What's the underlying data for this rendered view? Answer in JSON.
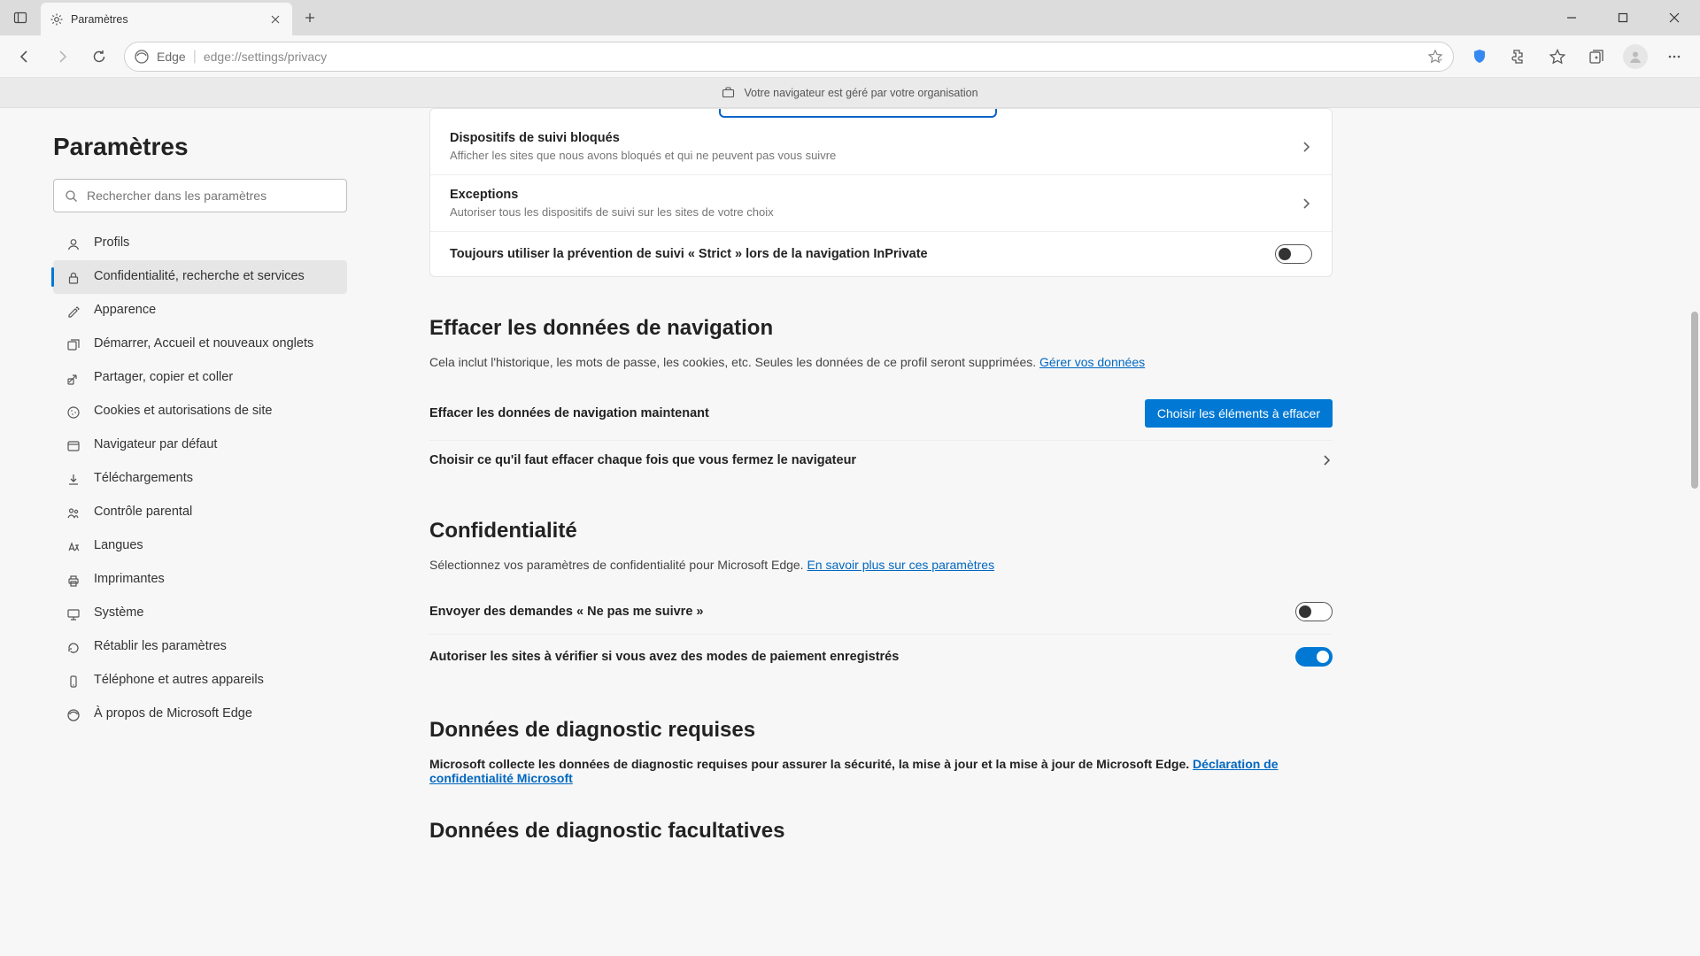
{
  "tab": {
    "title": "Paramètres"
  },
  "address": {
    "app": "Edge",
    "url": "edge://settings/privacy"
  },
  "org_banner": "Votre navigateur est géré par votre organisation",
  "sidebar": {
    "title": "Paramètres",
    "search_placeholder": "Rechercher dans les paramètres",
    "items": [
      "Profils",
      "Confidentialité, recherche et services",
      "Apparence",
      "Démarrer, Accueil et nouveaux onglets",
      "Partager, copier et coller",
      "Cookies et autorisations de site",
      "Navigateur par défaut",
      "Téléchargements",
      "Contrôle parental",
      "Langues",
      "Imprimantes",
      "Système",
      "Rétablir les paramètres",
      "Téléphone et autres appareils",
      "À propos de Microsoft Edge"
    ]
  },
  "card": {
    "rows": [
      {
        "title": "Dispositifs de suivi bloqués",
        "sub": "Afficher les sites que nous avons bloqués et qui ne peuvent pas vous suivre"
      },
      {
        "title": "Exceptions",
        "sub": "Autoriser tous les dispositifs de suivi sur les sites de votre choix"
      },
      {
        "title": "Toujours utiliser la prévention de suivi « Strict » lors de la navigation InPrivate"
      }
    ]
  },
  "clear": {
    "title": "Effacer les données de navigation",
    "desc": "Cela inclut l'historique, les mots de passe, les cookies, etc. Seules les données de ce profil seront supprimées. ",
    "link": "Gérer vos données",
    "row1": "Effacer les données de navigation maintenant",
    "btn": "Choisir les éléments à effacer",
    "row2": "Choisir ce qu'il faut effacer chaque fois que vous fermez le navigateur"
  },
  "privacy": {
    "title": "Confidentialité",
    "desc": "Sélectionnez vos paramètres de confidentialité pour Microsoft Edge. ",
    "link": "En savoir plus sur ces paramètres",
    "row1": "Envoyer des demandes « Ne pas me suivre »",
    "row2": "Autoriser les sites à vérifier si vous avez des modes de paiement enregistrés"
  },
  "diag_req": {
    "title": "Données de diagnostic requises",
    "desc": "Microsoft collecte les données de diagnostic requises pour assurer la sécurité, la mise à jour et la mise à jour de Microsoft Edge. ",
    "link": "Déclaration de confidentialité Microsoft"
  },
  "diag_opt": {
    "title": "Données de diagnostic facultatives"
  }
}
